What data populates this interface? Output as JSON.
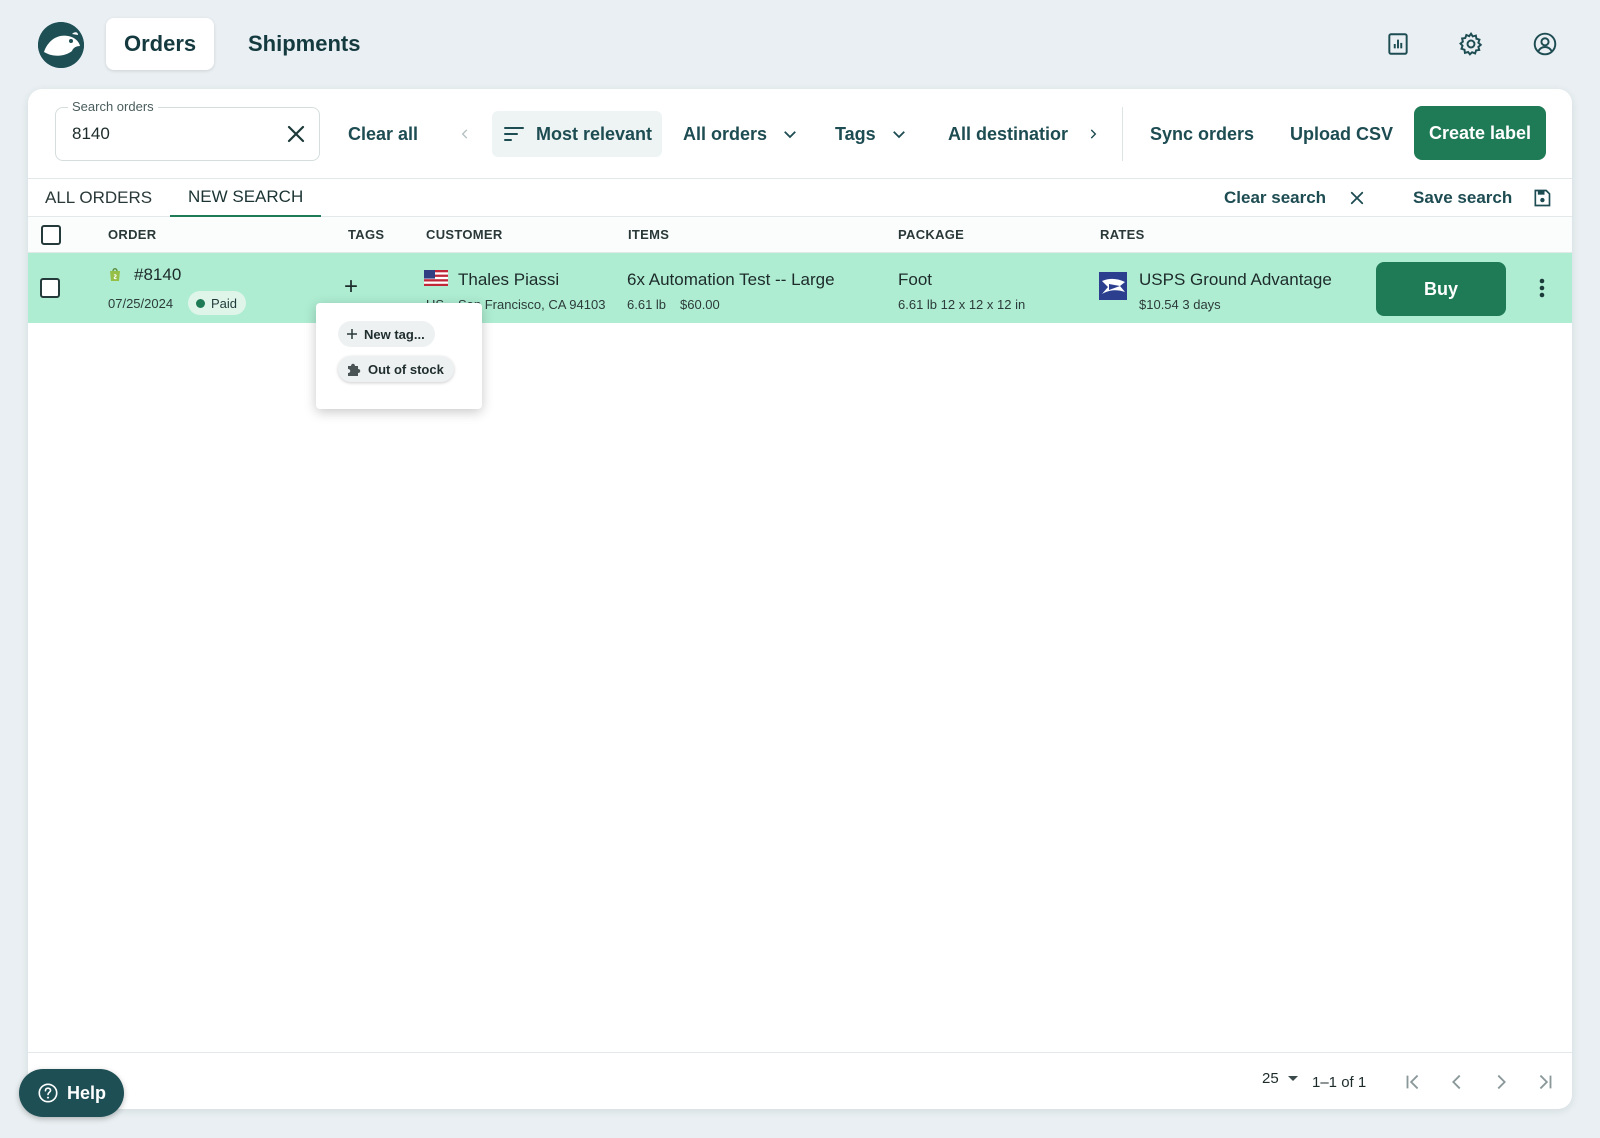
{
  "nav": {
    "tabs": [
      {
        "label": "Orders",
        "active": true
      },
      {
        "label": "Shipments",
        "active": false
      }
    ],
    "icons": [
      "reports-icon",
      "settings-gear-icon",
      "account-icon"
    ]
  },
  "filters": {
    "search_label": "Search orders",
    "search_value": "8140",
    "clear_all": "Clear all",
    "sort": "Most relevant",
    "orders_filter": "All orders",
    "tags_filter": "Tags",
    "destinations_filter": "All destinatior",
    "sync": "Sync orders",
    "upload": "Upload CSV",
    "create": "Create label"
  },
  "search_tabs": {
    "all_orders": "ALL ORDERS",
    "new_search": "NEW SEARCH",
    "clear_search": "Clear search",
    "save_search": "Save search"
  },
  "columns": {
    "order": "ORDER",
    "tags": "TAGS",
    "customer": "CUSTOMER",
    "items": "ITEMS",
    "package": "PACKAGE",
    "rates": "RATES"
  },
  "order": {
    "number": "#8140",
    "date": "07/25/2024",
    "status": "Paid",
    "tag_add": "+",
    "customer_name": "Thales Piassi",
    "country": "US",
    "customer_location": "San Francisco, CA 94103",
    "item_title": "6x Automation Test -- Large",
    "item_weight": "6.61 lb",
    "item_price": "$60.00",
    "package_name": "Foot",
    "package_details": "6.61 lb 12 x 12 x 12 in",
    "rate_service": "USPS Ground Advantage",
    "rate_details": "$10.54 3 days",
    "buy": "Buy"
  },
  "tag_menu": {
    "new_tag": "New tag...",
    "out_of_stock": "Out of stock"
  },
  "pagination": {
    "per_page": "25",
    "range": "1–1 of 1"
  },
  "help": "Help",
  "colors": {
    "accent": "#1f7a56",
    "row_highlight": "#aeedd2",
    "brand_dark": "#1d4f55",
    "background": "#e9eff2"
  }
}
